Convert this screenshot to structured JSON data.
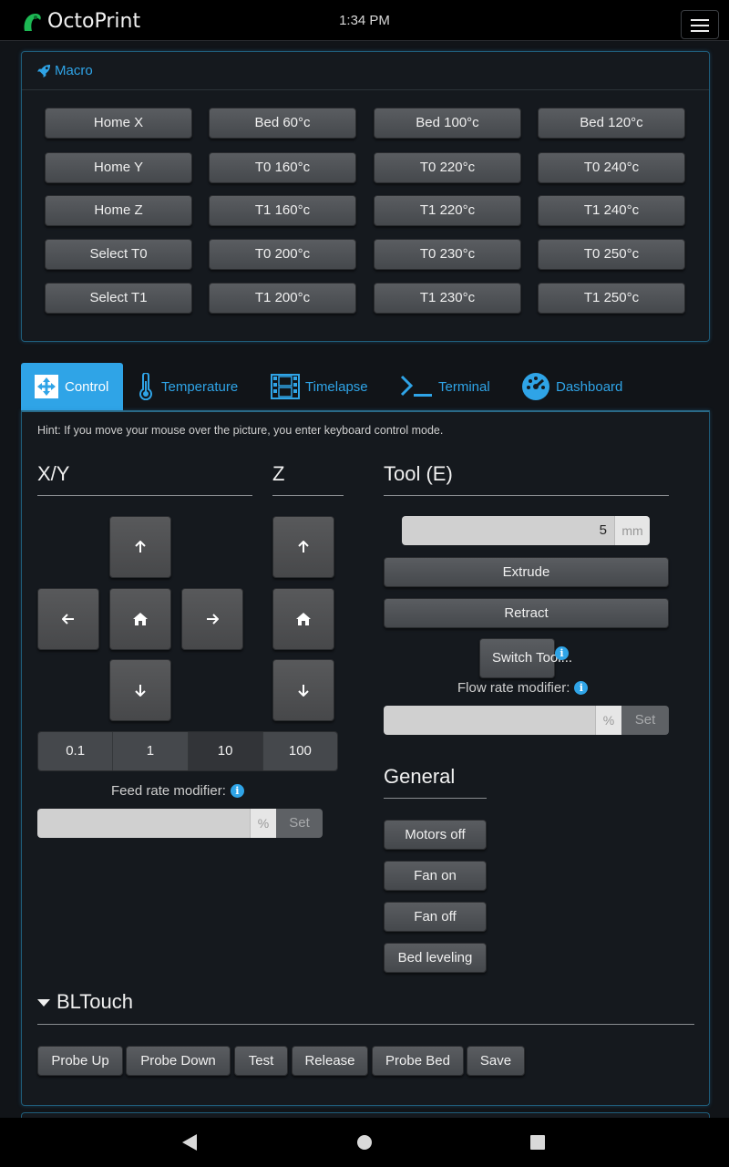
{
  "topbar": {
    "brand": "OctoPrint",
    "clock": "1:34 PM",
    "brand_color": "#1db954"
  },
  "macro": {
    "title": "Macro",
    "buttons": [
      [
        "Home X",
        "Bed 60°c",
        "Bed 100°c",
        "Bed 120°c"
      ],
      [
        "Home Y",
        "T0 160°c",
        "T0 220°c",
        "T0 240°c"
      ],
      [
        "Home Z",
        "T1 160°c",
        "T1 220°c",
        "T1 240°c"
      ],
      [
        "Select T0",
        "T0 200°c",
        "T0 230°c",
        "T0 250°c"
      ],
      [
        "Select T1",
        "T1 200°c",
        "T1 230°c",
        "T1 250°c"
      ]
    ]
  },
  "tabs": [
    {
      "label": "Control",
      "icon": "arrows-move-icon",
      "active": true
    },
    {
      "label": "Temperature",
      "icon": "thermometer-icon",
      "active": false
    },
    {
      "label": "Timelapse",
      "icon": "film-icon",
      "active": false
    },
    {
      "label": "Terminal",
      "icon": "terminal-icon",
      "active": false
    },
    {
      "label": "Dashboard",
      "icon": "gauge-icon",
      "active": false
    }
  ],
  "control": {
    "hint": "Hint: If you move your mouse over the picture, you enter keyboard control mode.",
    "xy_title": "X/Y",
    "z_title": "Z",
    "tool_title": "Tool (E)",
    "steps": [
      "0.1",
      "1",
      "10",
      "100"
    ],
    "active_step": "10",
    "feed_rate_label": "Feed rate modifier:",
    "feed_rate_unit": "%",
    "feed_rate_set": "Set",
    "extrude_amount": "5",
    "extrude_unit": "mm",
    "extrude_label": "Extrude",
    "retract_label": "Retract",
    "switch_tool_label": "Switch Tool...",
    "flow_rate_label": "Flow rate modifier:",
    "flow_rate_unit": "%",
    "flow_rate_set": "Set",
    "general_title": "General",
    "general_buttons": [
      "Motors off",
      "Fan on",
      "Fan off",
      "Bed leveling"
    ],
    "bltouch_title": "BLTouch",
    "bltouch_buttons": [
      "Probe Up",
      "Probe Down",
      "Test",
      "Release",
      "Probe Bed",
      "Save"
    ]
  },
  "colors": {
    "accent": "#2fa4e7",
    "panel_border": "#1f5d7a"
  }
}
